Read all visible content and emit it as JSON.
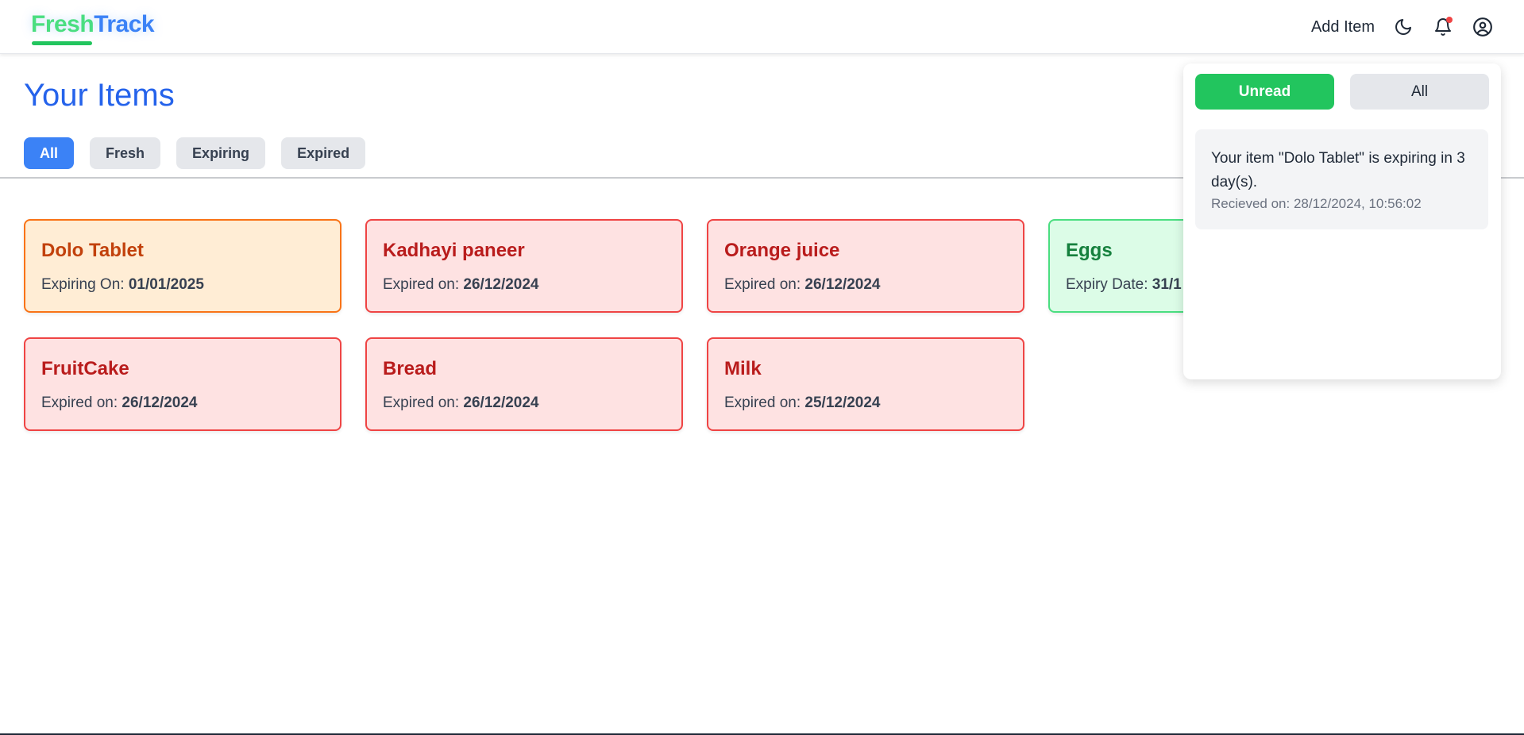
{
  "logo": {
    "part1": "Fresh",
    "part2": "Track"
  },
  "nav": {
    "add_item": "Add Item",
    "icons": [
      "moon-icon",
      "bell-icon",
      "user-icon"
    ]
  },
  "page": {
    "title": "Your Items"
  },
  "filters": [
    {
      "label": "All",
      "active": true
    },
    {
      "label": "Fresh",
      "active": false
    },
    {
      "label": "Expiring",
      "active": false
    },
    {
      "label": "Expired",
      "active": false
    }
  ],
  "items": [
    {
      "name": "Dolo Tablet",
      "date_label": "Expiring On: ",
      "date": "01/01/2025",
      "status": "expiring"
    },
    {
      "name": "Kadhayi paneer",
      "date_label": "Expired on: ",
      "date": "26/12/2024",
      "status": "expired"
    },
    {
      "name": "Orange juice",
      "date_label": "Expired on: ",
      "date": "26/12/2024",
      "status": "expired"
    },
    {
      "name": "Eggs",
      "date_label": "Expiry Date: ",
      "date": "31/1",
      "status": "fresh"
    },
    {
      "name": "FruitCake",
      "date_label": "Expired on: ",
      "date": "26/12/2024",
      "status": "expired"
    },
    {
      "name": "Bread",
      "date_label": "Expired on: ",
      "date": "26/12/2024",
      "status": "expired"
    },
    {
      "name": "Milk",
      "date_label": "Expired on: ",
      "date": "25/12/2024",
      "status": "expired"
    }
  ],
  "notifications": {
    "tabs": {
      "unread": "Unread",
      "all": "All"
    },
    "items": [
      {
        "message": "Your item \"Dolo Tablet\" is expiring in 3 day(s).",
        "time": "Recieved on: 28/12/2024, 10:56:02"
      }
    ]
  },
  "colors": {
    "accent_blue": "#3b82f6",
    "fresh_green": "#22c55e",
    "expired_red": "#ef4444",
    "expiring_orange": "#f97316"
  }
}
